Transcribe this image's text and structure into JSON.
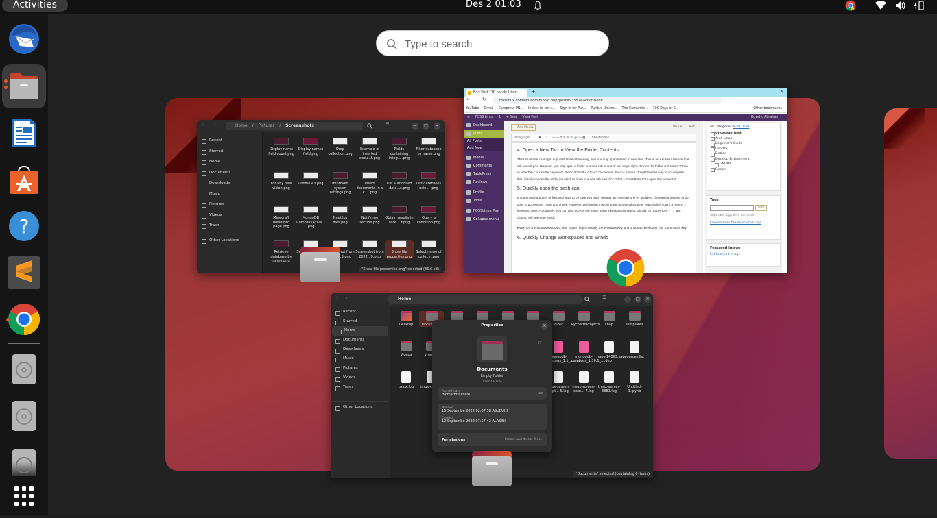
{
  "topbar": {
    "activities_label": "Activities",
    "clock": "Des 2  01:03",
    "tray_icons": [
      "chrome-icon",
      "wifi-icon",
      "volume-icon",
      "battery-icon"
    ]
  },
  "dock": {
    "items": [
      {
        "name": "thunderbird",
        "running": false
      },
      {
        "name": "files",
        "running": true,
        "active": true
      },
      {
        "name": "libreoffice-writer",
        "running": false
      },
      {
        "name": "ubuntu-software",
        "running": false
      },
      {
        "name": "help",
        "running": false
      },
      {
        "name": "sublime-text",
        "running": false
      },
      {
        "name": "google-chrome",
        "running": true
      },
      {
        "name": "disc-1",
        "running": false
      },
      {
        "name": "disc-2",
        "running": false
      },
      {
        "name": "disc-3",
        "running": false
      },
      {
        "name": "show-applications",
        "running": false
      }
    ]
  },
  "search": {
    "placeholder": "Type to search",
    "value": ""
  },
  "files_window_1": {
    "breadcrumb": [
      "Home",
      "Pictures",
      "Screenshots"
    ],
    "sidebar": [
      "Recent",
      "Starred",
      "Home",
      "Documents",
      "Downloads",
      "Music",
      "Pictures",
      "Videos",
      "Trash",
      "Other Locations"
    ],
    "files": [
      "Display name field count.png",
      "Display names field.png",
      "Drop collection.png",
      "Example of inserted docu...t.png",
      "Fields containing integ... .png",
      "Filter database by name.png",
      "For any new vision.png",
      "Gnome 43.png",
      "Improved system settings.png",
      "Insert documents in a c... .png",
      "List authorized data...s.png",
      "List databases usin... .png",
      "Minecraft download page.png",
      "MongoDB Compass Priva... .png",
      "Nautilus files.png",
      "Notify me section.png",
      "Obtain results in asce... r.png",
      "Query a condition.png",
      "Retrieve database by name.png",
      "Screenshot from 2022...3.png",
      "Screenshot from 2022...3.png",
      "Screenshot from 2022...9.png",
      "Show file properties.png",
      "Select name of colle...n.png"
    ],
    "selected_index": 22,
    "status": "\"Show file properties.png\" selected  (36.6 kB)"
  },
  "chrome_window": {
    "tab_title": "Edit Post \"10 handy Ubun",
    "url": "fosslinux.com/wp-admin/post.php?post=93552&action=edit",
    "bookmarks": [
      "YouTube",
      "Gmail",
      "Compress PN...",
      "Inches to cm c...",
      "Sign in for Pur...",
      "Purdue Univer...",
      "The Complete...",
      "100 Days of S...",
      "Other bookmarks"
    ],
    "wp_adminbar": {
      "site": "FOSS Linux",
      "comments": "1",
      "new": "+ New",
      "view": "View Post",
      "howdy": "Howdy, Abraham"
    },
    "wp_menu": [
      "Dashboard",
      "Posts",
      "All Posts",
      "Add New",
      "Media",
      "Comments",
      "TablePress",
      "Reviews",
      "Profile",
      "Tools",
      "FOSSLinux Pay",
      "Collapse menu"
    ],
    "editor": {
      "add_media": "Add Media",
      "tab_visual": "Visual",
      "tab_text": "Text",
      "format": "Paragraph",
      "shortcodes": "Shortcodes",
      "heading_4": "4. Open a New Tab to View the Folder Contents",
      "para_4": "The Ubuntu file manager supports tabbed browsing, and you may open folders in new tabs. This is an excellent feature that will benefit you. However, you may open a folder in a new tab in one of two ways: right-click on the folder and select \"Open in New Tab,\" or use the keyboard shortcut \"Shift + Ctrl + T.\" However, there is a more straightforward way to accomplish this. Simply choose the folder you wish to open in a new tab and click \"Shift + Enter/Return\" to open it in a new tab.",
      "heading_5": "5. Quickly open the trash can",
      "para_5": "If you erased a bunch of files and want to be sure you didn't destroy an essential one by accident, the easiest method to do so is to access the Trash and check. However, performing this using the mouse takes time, especially if you're a heavy keyboard user. Fortunately, you can also access the Trash using a keyboard shortcut. Simply hit \"Super Key + T,\" and Ubuntu will open the Trash.",
      "note_label": "Note:",
      "note": " On a Windows keyboard, the \"Super\" key is usually the Windows key, and on a Mac keyboard, the \"Command\" key.",
      "heading_6": "6. Quickly Change Workspaces and Windo"
    },
    "categories": {
      "tab_all": "All Categories",
      "tab_most": "Most Used",
      "items": [
        {
          "label": "Uncategorized",
          "checked": true
        },
        {
          "label": "Arch Linux",
          "checked": false
        },
        {
          "label": "Beginner's Guide",
          "checked": false
        },
        {
          "label": "CentOS",
          "checked": false
        },
        {
          "label": "Debian",
          "checked": false
        },
        {
          "label": "Desktop Environment",
          "checked": false
        },
        {
          "label": "GNOME",
          "checked": false
        },
        {
          "label": "Deepin",
          "checked": false
        }
      ]
    },
    "tags": {
      "title": "Tags",
      "add": "Add",
      "hint": "Separate tags with commas",
      "link": "Choose from the most used tags"
    },
    "featured": {
      "title": "Featured image",
      "link": "Set featured image"
    }
  },
  "files_window_2": {
    "breadcrumb": "Home",
    "sidebar": [
      "Recent",
      "Starred",
      "Home",
      "Documents",
      "Downloads",
      "Music",
      "Pictures",
      "Videos",
      "Trash",
      "Other Locations"
    ],
    "active_sidebar": "Home",
    "files": [
      "Desktop",
      "Documents",
      "",
      "",
      "",
      "",
      "Public",
      "PycharmProjects",
      "snap",
      "Templates",
      "Videos",
      "vmware",
      "mongodb-compass_1.1_....deb",
      "mongodb-compass_1.30.1_....deb",
      "nano.14063.save",
      "sources.list",
      "tmux.log",
      "tmux-client...",
      "tmux-screen-capt... 5.log",
      "tmux-screen-capt... 7.log",
      "tmux-server-3881.log",
      "Untitled-1.ipynb"
    ],
    "status": "\"Documents\" selected  (containing 0 items)",
    "properties": {
      "title": "Properties",
      "name": "Documents",
      "type": "Empty Folder",
      "free": "113.6 GB Free",
      "parent_label": "Parent Folder",
      "parent": "/home/fosslinux/",
      "modified_label": "Modified",
      "modified": "16 Septembe 2022 02:07:38 ASUBUHI",
      "created_label": "Created",
      "created": "12 Septembe 2022 07:57:42 ALASIRI",
      "permissions_label": "Permissions",
      "permissions_value": "Create and delete files"
    }
  },
  "colors": {
    "accent": "#e95420",
    "panel": "#121212",
    "dock": "#151515",
    "overview_bg": "#222222"
  }
}
